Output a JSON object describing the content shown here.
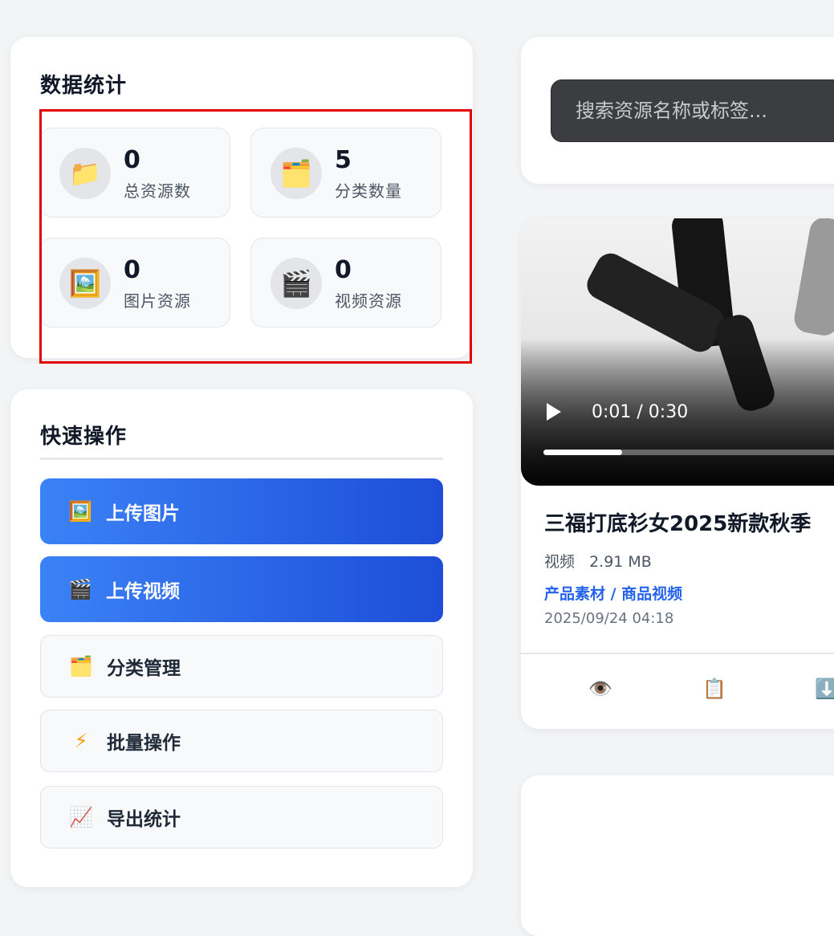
{
  "stats": {
    "title": "数据统计",
    "items": [
      {
        "value": "0",
        "label": "总资源数",
        "icon": "folder-icon",
        "glyph": "📁"
      },
      {
        "value": "5",
        "label": "分类数量",
        "icon": "card-index-dividers-icon",
        "glyph": "🗂️"
      },
      {
        "value": "0",
        "label": "图片资源",
        "icon": "framed-picture-icon",
        "glyph": "🖼️"
      },
      {
        "value": "0",
        "label": "视频资源",
        "icon": "clapper-board-icon",
        "glyph": "🎬"
      }
    ]
  },
  "quick_actions": {
    "title": "快速操作",
    "buttons": [
      {
        "label": "上传图片",
        "icon": "framed-picture-icon",
        "glyph": "🖼️",
        "style": "primary"
      },
      {
        "label": "上传视频",
        "icon": "clapper-board-icon",
        "glyph": "🎬",
        "style": "primary"
      },
      {
        "label": "分类管理",
        "icon": "card-index-dividers-icon",
        "glyph": "🗂️",
        "style": "secondary"
      },
      {
        "label": "批量操作",
        "icon": "lightning-icon",
        "glyph": "⚡",
        "style": "secondary"
      },
      {
        "label": "导出统计",
        "icon": "chart-increasing-icon",
        "glyph": "📈",
        "style": "secondary"
      }
    ]
  },
  "search": {
    "placeholder": "搜索资源名称或标签..."
  },
  "resource": {
    "title": "三福打底衫女2025新款秋季",
    "type": "视频",
    "size": "2.91 MB",
    "category": "产品素材 / 商品视频",
    "date": "2025/09/24 04:18",
    "video": {
      "time": "0:01 / 0:30",
      "progress": 0.033
    },
    "actions": [
      {
        "icon": "eye-icon",
        "glyph": "👁️"
      },
      {
        "icon": "clipboard-icon",
        "glyph": "📋"
      },
      {
        "icon": "download-icon",
        "glyph": "⬇️"
      }
    ]
  },
  "colors": {
    "primary_gradient_start": "#3b82f6",
    "primary_gradient_end": "#1d4ed8",
    "category_link": "#2563eb",
    "highlight_border": "#e00000"
  }
}
